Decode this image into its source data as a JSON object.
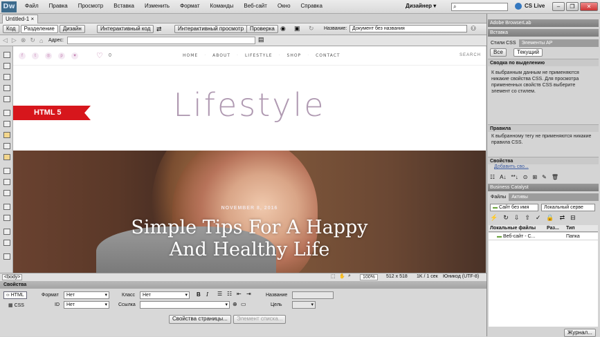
{
  "app": {
    "logo": "Dw",
    "workspace": "Дизайнер ▾",
    "cs_live": "CS Live"
  },
  "menu": [
    "Файл",
    "Правка",
    "Просмотр",
    "Вставка",
    "Изменить",
    "Формат",
    "Команды",
    "Веб-сайт",
    "Окно",
    "Справка"
  ],
  "window_controls": [
    "‒",
    "❐",
    "✕"
  ],
  "document": {
    "tab": "Untitled-1",
    "tab_close": "×"
  },
  "view_toolbar": {
    "code": "Код",
    "split": "Разделение",
    "design": "Дизайн",
    "live_code": "Интерактивный код",
    "live_view": "Интерактивный просмотр",
    "inspect": "Проверка",
    "title_label": "Название:",
    "title_value": "Документ без названия"
  },
  "address": {
    "label": "Адрес:"
  },
  "site": {
    "heart_count": "0",
    "nav": [
      "HOME",
      "ABOUT",
      "LIFESTYLE",
      "SHOP",
      "CONTACT"
    ],
    "search": "SEARCH",
    "title": "Lifestyle",
    "badge": "HTML 5",
    "post_date": "NOVEMBER 8, 2016",
    "post_title_line1": "Simple Tips For A Happy",
    "post_title_line2": "And Healthy Life",
    "social_icons": [
      "f",
      "t",
      "◎",
      "p",
      "♥"
    ]
  },
  "status": {
    "tag": "<body>",
    "zoom": "100%",
    "size": "512 x 518",
    "weight": "1K / 1 сек",
    "encoding": "Юникод (UTF-8)"
  },
  "properties": {
    "header": "Свойства",
    "html_btn": "HTML",
    "css_btn": "CSS",
    "format_label": "Формат",
    "format_value": "Нет",
    "class_label": "Класс",
    "class_value": "Нет",
    "title_label": "Название",
    "id_label": "ID",
    "id_value": "Нет",
    "link_label": "Ссылка",
    "target_label": "Цель",
    "page_props": "Свойства страницы...",
    "list_item": "Элемент списка...",
    "bold": "B",
    "italic": "I"
  },
  "right_panel": {
    "browserlab": "Adobe BrowserLab",
    "insert": "Вставка",
    "css_styles_tab": "Стили CSS",
    "ap_tab": "Элементы AP",
    "all_btn": "Все",
    "current_btn": "Текущий",
    "summary_head": "Сводка по выделению",
    "summary_text": "К выбранным данным не применяются никакие свойства CSS.  Для просмотра примененных свойств CSS выберите элемент со стилем.",
    "rules_head": "Правила",
    "rules_text": "К выбранному тегу не применяются никакие правила CSS.",
    "props_head": "Свойства",
    "add_prop": "Добавить сво...",
    "catalyst": "Business Catalyst",
    "files_tab": "Файлы",
    "assets_tab": "Активы",
    "site_select": "Сайт без имя",
    "local_select": "Локальный серве",
    "col_local": "Локальные файлы",
    "col_size": "Раз...",
    "col_type": "Тип",
    "site_row": "Веб-сайт - С...",
    "site_type": "Папка",
    "log_btn": "Журнал..."
  }
}
